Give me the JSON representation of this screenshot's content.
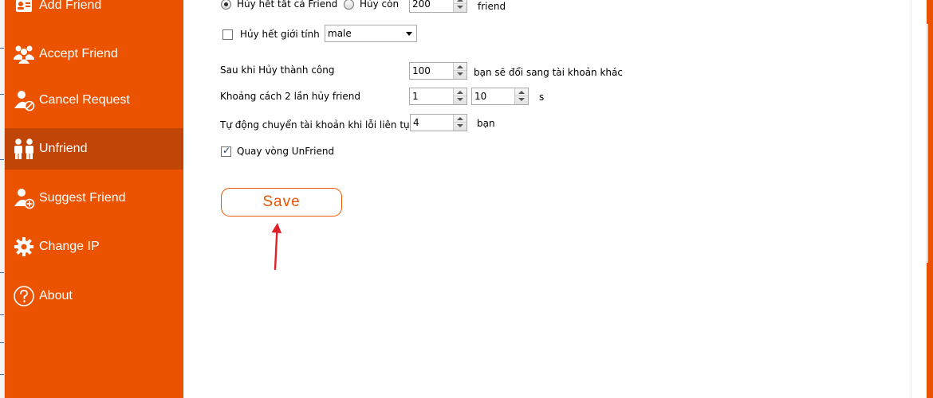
{
  "sidebar": {
    "items": [
      {
        "label": "Add Friend",
        "icon": "address-card-icon",
        "active": false
      },
      {
        "label": "Accept Friend",
        "icon": "users-group-icon",
        "active": false
      },
      {
        "label": "Cancel Request",
        "icon": "user-cancel-icon",
        "active": false
      },
      {
        "label": "Unfriend",
        "icon": "users-pair-icon",
        "active": true
      },
      {
        "label": "Suggest Friend",
        "icon": "user-add-icon",
        "active": false
      },
      {
        "label": "Change IP",
        "icon": "gear-icon",
        "active": false
      },
      {
        "label": "About",
        "icon": "question-circle-icon",
        "active": false
      }
    ]
  },
  "form": {
    "mode_all_label": "Hủy hết tất cả Friend",
    "mode_keep_label": "Hủy còn",
    "keep_count": "200",
    "keep_unit": "friend",
    "gender_checkbox_label": "Hủy hết giới tính",
    "gender_value": "male",
    "switch_after_label": "Sau khi Hủy thành công",
    "switch_after_value": "100",
    "switch_after_suffix": "bạn sẽ đổi sang tài khoản khác",
    "interval_label": "Khoảng cách 2 lần hủy friend",
    "interval_min": "1",
    "interval_max": "10",
    "interval_unit": "s",
    "auto_switch_label": "Tự động chuyển tài khoản khi lỗi liên tục",
    "auto_switch_value": "4",
    "auto_switch_unit": "bạn",
    "loop_label": "Quay vòng  UnFriend",
    "loop_checked": true,
    "gender_checked": false,
    "mode_all_selected": true
  },
  "actions": {
    "save_label": "Save"
  },
  "colors": {
    "brand": "#ec5300",
    "active_item": "#c24508",
    "arrow": "#e0202a"
  }
}
